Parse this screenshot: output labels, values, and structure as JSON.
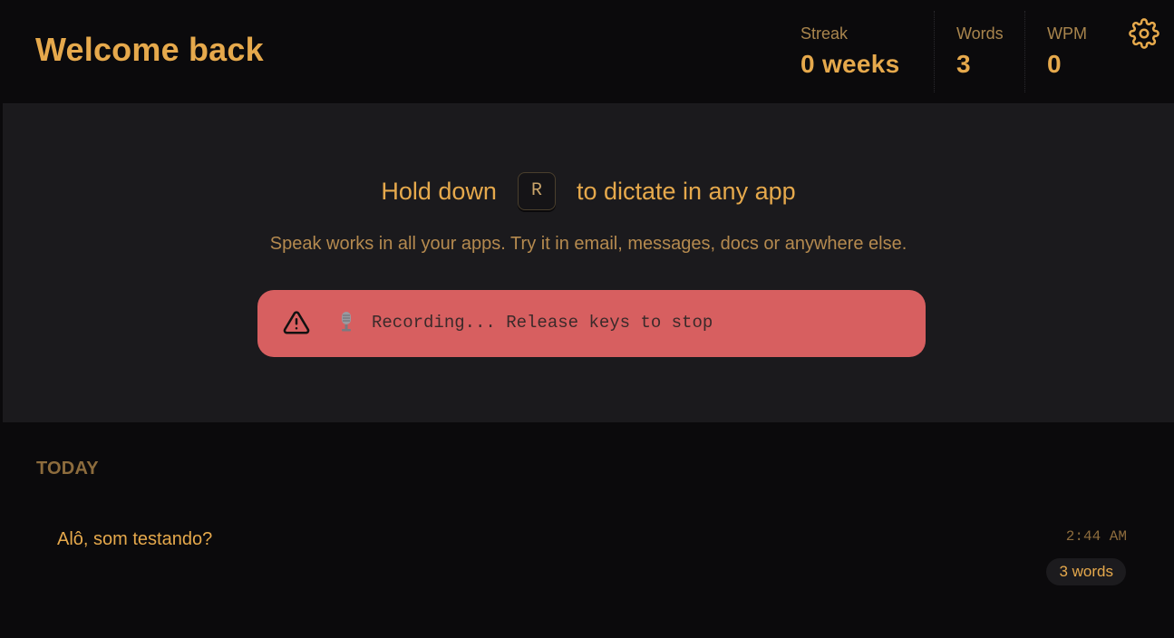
{
  "header": {
    "title": "Welcome back",
    "stats": [
      {
        "label": "Streak",
        "value": "0 weeks"
      },
      {
        "label": "Words",
        "value": "3"
      },
      {
        "label": "WPM",
        "value": "0"
      }
    ],
    "settings_icon": "gear-icon"
  },
  "hero": {
    "hold_prefix": "Hold down",
    "hotkey": "R",
    "hold_suffix": "to dictate in any app",
    "subtitle": "Speak works in all your apps. Try it in email, messages, docs or anywhere else.",
    "alert": {
      "icon": "warning-icon",
      "mic_icon": "microphone-icon",
      "message": "Recording... Release keys to stop",
      "color": "#d75f60"
    }
  },
  "history": {
    "section_label": "TODAY",
    "entries": [
      {
        "text": "Alô, som testando?",
        "time": "2:44 AM",
        "words": "3 words"
      }
    ]
  },
  "colors": {
    "accent": "#e6a94c",
    "muted_accent": "#8d6c3d",
    "background": "#0b0a0c",
    "panel": "#1b1a1d"
  }
}
